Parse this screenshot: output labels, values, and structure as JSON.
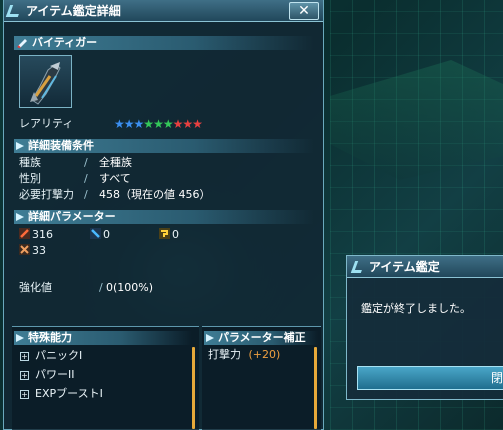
{
  "window": {
    "title": "アイテム鑑定詳細",
    "close_label": "✕"
  },
  "item": {
    "name": "バイティガー"
  },
  "rarity": {
    "label": "レアリティ",
    "value": 9,
    "max": 9,
    "star_colors": [
      "#3b8ff0",
      "#3b8ff0",
      "#3b8ff0",
      "#34c85a",
      "#34c85a",
      "#34c85a",
      "#e84040",
      "#e84040",
      "#e84040"
    ]
  },
  "equip": {
    "header": "詳細装備条件",
    "rows": [
      {
        "label": "種族",
        "value": "全種族"
      },
      {
        "label": "性別",
        "value": "すべて"
      },
      {
        "label": "必要打撃力",
        "value": "458（現在の値 456）"
      }
    ]
  },
  "params": {
    "header": "詳細パラメーター",
    "melee": "316",
    "ranged": "0",
    "tech": "0",
    "dex": "33"
  },
  "enhance": {
    "label": "強化値",
    "value": "0(100%)"
  },
  "special": {
    "header": "特殊能力",
    "items": [
      "パニックI",
      "パワーII",
      "EXPブーストI"
    ]
  },
  "bonus": {
    "header": "パラメーター補正",
    "label": "打撃力",
    "value": "(+20)"
  },
  "dialog": {
    "title": "アイテム鑑定",
    "message": "鑑定が終了しました。",
    "button_label": "閉"
  },
  "colors": {
    "accent": "#e7a93a",
    "bonus_value": "#f0a040",
    "panel_border": "#6aa9bd"
  }
}
